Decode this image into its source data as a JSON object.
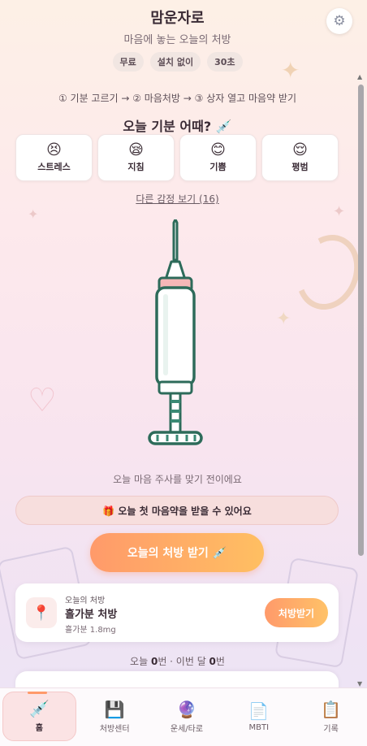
{
  "app": {
    "title": "맘운자로",
    "subtitle": "마음에 놓는 오늘의 처방",
    "chips": [
      "무료",
      "설치 없이",
      "30초"
    ]
  },
  "steps": "① 기분 고르기 → ② 마음처방 → ③ 상자 열고 마음약 받기",
  "mood": {
    "question": "오늘 기분 어때? 💉",
    "options": [
      {
        "emoji": "😣",
        "label": "스트레스"
      },
      {
        "emoji": "😪",
        "label": "지침"
      },
      {
        "emoji": "😊",
        "label": "기쁨"
      },
      {
        "emoji": "😌",
        "label": "평범"
      }
    ],
    "more_link": "다른 감정 보기 (16)"
  },
  "syringe_caption": "오늘 마음 주사를 맞기 전이에요",
  "notice": "🎁 오늘 첫 마음약을 받을 수 있어요",
  "main_button": "오늘의 처방 받기 💉",
  "prescription_card": {
    "small_label": "오늘의 처방",
    "name": "흘가분 처방",
    "dose": "흘가분 1.8mg",
    "icon": "📍",
    "button": "처방받기"
  },
  "counts": {
    "today_prefix": "오늘 ",
    "today_value": "0",
    "today_suffix": "번 · 이번 달 ",
    "month_value": "0",
    "month_suffix": "번"
  },
  "nav": [
    {
      "icon": "💉",
      "label": "홈",
      "active": true
    },
    {
      "icon": "💾",
      "label": "처방센터"
    },
    {
      "icon": "🔮",
      "label": "운세/타로"
    },
    {
      "icon": "📄",
      "label": "MBTI"
    },
    {
      "icon": "📋",
      "label": "기록"
    }
  ],
  "colors": {
    "accent_start": "#ff9a6a",
    "accent_end": "#ffbf62",
    "syringe_outline": "#2d6b5a"
  }
}
